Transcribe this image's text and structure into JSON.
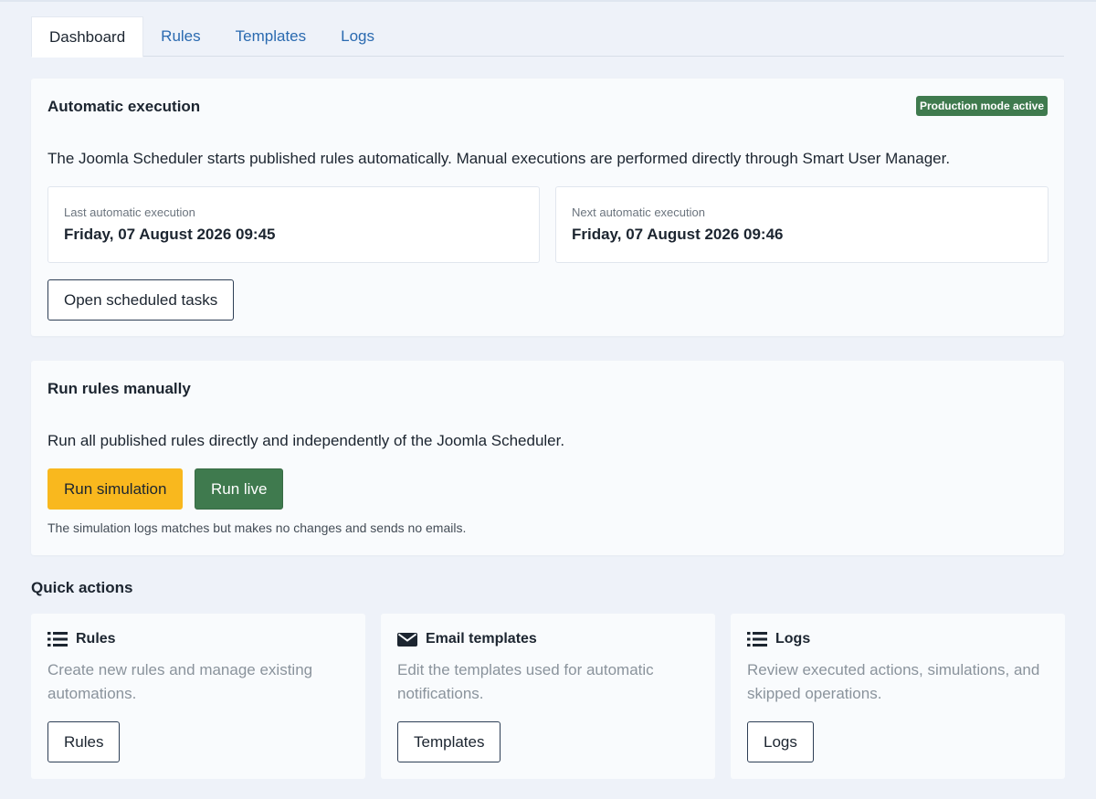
{
  "tabs": [
    {
      "label": "Dashboard"
    },
    {
      "label": "Rules"
    },
    {
      "label": "Templates"
    },
    {
      "label": "Logs"
    }
  ],
  "automatic": {
    "title": "Automatic execution",
    "badge": "Production mode active",
    "description": "The Joomla Scheduler starts published rules automatically. Manual executions are performed directly through Smart User Manager.",
    "last_label": "Last automatic execution",
    "last_value": "Friday, 07 August 2026 09:45",
    "next_label": "Next automatic execution",
    "next_value": "Friday, 07 August 2026 09:46",
    "open_button": "Open scheduled tasks"
  },
  "manual": {
    "title": "Run rules manually",
    "description": "Run all published rules directly and independently of the Joomla Scheduler.",
    "simulation_button": "Run simulation",
    "live_button": "Run live",
    "hint": "The simulation logs matches but makes no changes and sends no emails."
  },
  "quick_actions": {
    "title": "Quick actions",
    "cards": [
      {
        "icon": "list-icon",
        "title": "Rules",
        "text": "Create new rules and manage existing automations.",
        "button": "Rules"
      },
      {
        "icon": "envelope-icon",
        "title": "Email templates",
        "text": "Edit the templates used for automatic notifications.",
        "button": "Templates"
      },
      {
        "icon": "list-icon",
        "title": "Logs",
        "text": "Review executed actions, simulations, and skipped operations.",
        "button": "Logs"
      }
    ]
  },
  "colors": {
    "background": "#eef2f9",
    "link": "#2a6ab0",
    "success": "#3f7a4e",
    "warning": "#f9b81e"
  }
}
